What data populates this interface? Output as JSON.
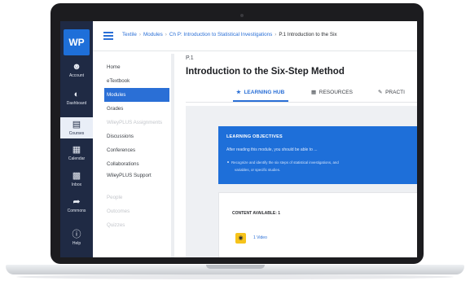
{
  "app": {
    "logo": "WP"
  },
  "global_nav": [
    {
      "label": "Account",
      "icon": "user-icon"
    },
    {
      "label": "Dashboard",
      "icon": "dashboard-icon"
    },
    {
      "label": "Courses",
      "icon": "book-icon",
      "active": true
    },
    {
      "label": "Calendar",
      "icon": "calendar-icon"
    },
    {
      "label": "Inbox",
      "icon": "inbox-icon"
    },
    {
      "label": "Commons",
      "icon": "commons-icon"
    },
    {
      "label": "Help",
      "icon": "help-icon"
    }
  ],
  "breadcrumb": {
    "items": [
      "Textile",
      "Modules",
      "Ch P: Introduction to Statistical Investigations"
    ],
    "current": "P.1 Introduction to the Six"
  },
  "course_nav": [
    {
      "label": "Home"
    },
    {
      "label": "eTextbook"
    },
    {
      "label": "Modules",
      "active": true
    },
    {
      "label": "Grades"
    },
    {
      "label": "WileyPLUS Assignments",
      "dim": true
    },
    {
      "label": "Discussions"
    },
    {
      "label": "Conferences"
    },
    {
      "label": "Collaborations"
    },
    {
      "label": "WileyPLUS Support"
    },
    {
      "label": "People",
      "dim": true
    },
    {
      "label": "Outcomes",
      "dim": true
    },
    {
      "label": "Quizzes",
      "dim": true
    }
  ],
  "page": {
    "eyebrow": "P.1",
    "title": "Introduction to the Six-Step Method"
  },
  "tabs": [
    {
      "label": "LEARNING HUB",
      "icon": "star-icon",
      "active": true
    },
    {
      "label": "RESOURCES",
      "icon": "grid-icon"
    },
    {
      "label": "PRACTI",
      "icon": "pencil-icon"
    }
  ],
  "learning_objectives": {
    "title": "LEARNING OBJECTIVES",
    "intro": "After reading this module, you should be able to ...",
    "bullet_line1": "Recognize and identify the six steps of statistical investigations, and",
    "bullet_line2": "variables, or specific studies."
  },
  "content_available": {
    "title": "CONTENT AVAILABLE: 1",
    "item_label": "1 Video",
    "item_icon": "play-icon"
  },
  "colors": {
    "nav_bg": "#1f2a44",
    "accent": "#2a6fd6",
    "objectives_bg": "#1e6fd9",
    "video_icon_bg": "#f6c31b"
  }
}
